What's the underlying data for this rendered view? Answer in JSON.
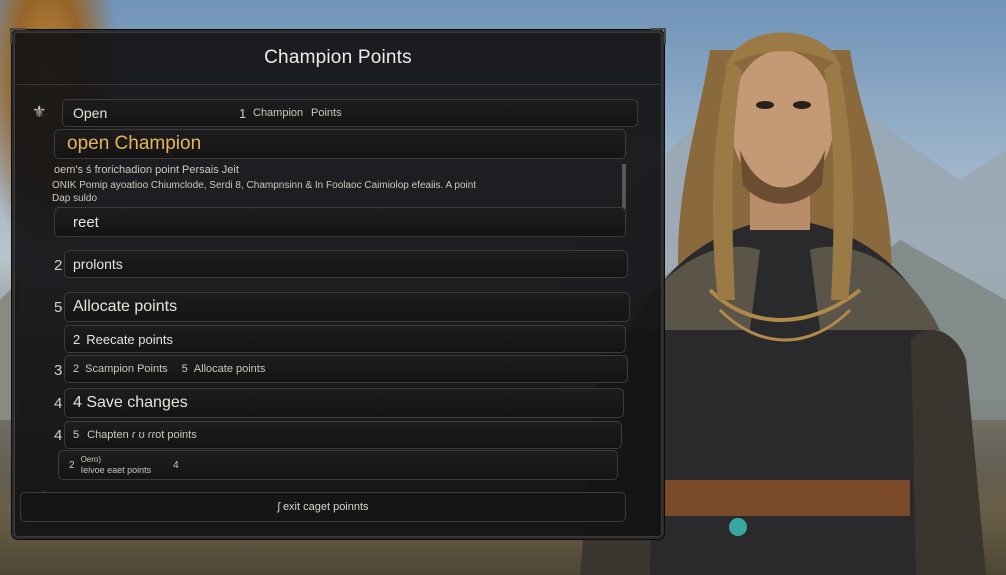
{
  "panel": {
    "title": "Champion Points"
  },
  "rows": {
    "open_label": "Open",
    "open_number": "1",
    "open_cp_a": "Champion",
    "open_cp_b": "Points",
    "open_champion": "open Champion",
    "desc_line1": "oem's ś frorichadion point Persais Jeit",
    "desc_line2": "ONIK Pomip ayoatioo Chiumclode, Serdi 8, Champnsinn & In Foolaoc Caimiolop efeaiis. A point",
    "desc_line3": "Dap suldo",
    "reet": "reet",
    "prolonts_num": "2",
    "prolonts": "prolonts",
    "allocate_num": "5",
    "allocate": "Allocate points",
    "reecate_num": "2",
    "reecate": "Reecate points",
    "scampion_left_num": "3",
    "scampion_num": "2",
    "scampion": "Scampion Points",
    "scampion_alloc_num": "5",
    "scampion_alloc": "Allocate points",
    "save_left_num": "4",
    "save": "4 Save changes",
    "chapter_left_num": "4",
    "chapter_num": "5",
    "chapter": "Chapten ɾ ʊ ɾɾot points",
    "last_num": "2",
    "last_top": "Oero)",
    "last_bottom": "Ieivoe eaet points",
    "last_right": "4"
  },
  "footer": {
    "label": "ʃ exit caget poinnts"
  },
  "icons": {
    "ornament_top": "fleur-ornament",
    "ornament_bottom": "fleur-ornament"
  }
}
